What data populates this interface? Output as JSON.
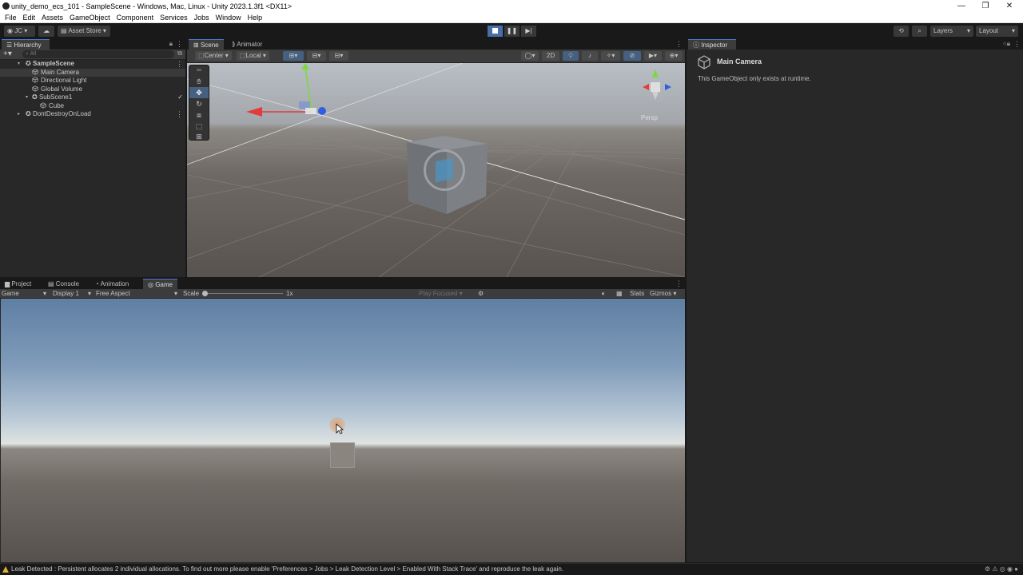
{
  "window": {
    "title": "unity_demo_ecs_101 - SampleScene - Windows, Mac, Linux - Unity 2023.1.3f1 <DX11>",
    "minimize": "—",
    "restore": "❐",
    "close": "✕"
  },
  "menu": [
    "File",
    "Edit",
    "Assets",
    "GameObject",
    "Component",
    "Services",
    "Jobs",
    "Window",
    "Help"
  ],
  "toolbar": {
    "account": "JC",
    "asset_store": "Asset Store",
    "layers": "Layers",
    "layout": "Layout"
  },
  "hierarchy": {
    "tab": "Hierarchy",
    "search_placeholder": "All",
    "items": [
      {
        "label": "SampleScene"
      },
      {
        "label": "Main Camera"
      },
      {
        "label": "Directional Light"
      },
      {
        "label": "Global Volume"
      },
      {
        "label": "SubScene1"
      },
      {
        "label": "Cube"
      },
      {
        "label": "DontDestroyOnLoad"
      }
    ]
  },
  "scene": {
    "tabs": [
      "Scene",
      "Animator"
    ],
    "pivot": "Center",
    "space": "Local",
    "mode_2d": "2D",
    "persp": "Persp"
  },
  "inspector": {
    "tab": "Inspector",
    "object_name": "Main Camera",
    "note": "This GameObject only exists at runtime."
  },
  "bottom": {
    "tabs": [
      "Project",
      "Console",
      "Animation",
      "Game"
    ],
    "game_mode": "Game",
    "display": "Display 1",
    "aspect": "Free Aspect",
    "scale_label": "Scale",
    "scale_value": "1x",
    "play_focused": "Play Focused",
    "stats": "Stats",
    "gizmos": "Gizmos"
  },
  "status": {
    "message": "Leak Detected : Persistent allocates 2 individual allocations. To find out more please enable 'Preferences > Jobs > Leak Detection Level > Enabled With Stack Trace' and reproduce the leak again."
  },
  "colors": {
    "selection_accent": "#4d78cc",
    "panel_bg": "#282828",
    "status_warning": "#e0b030"
  }
}
